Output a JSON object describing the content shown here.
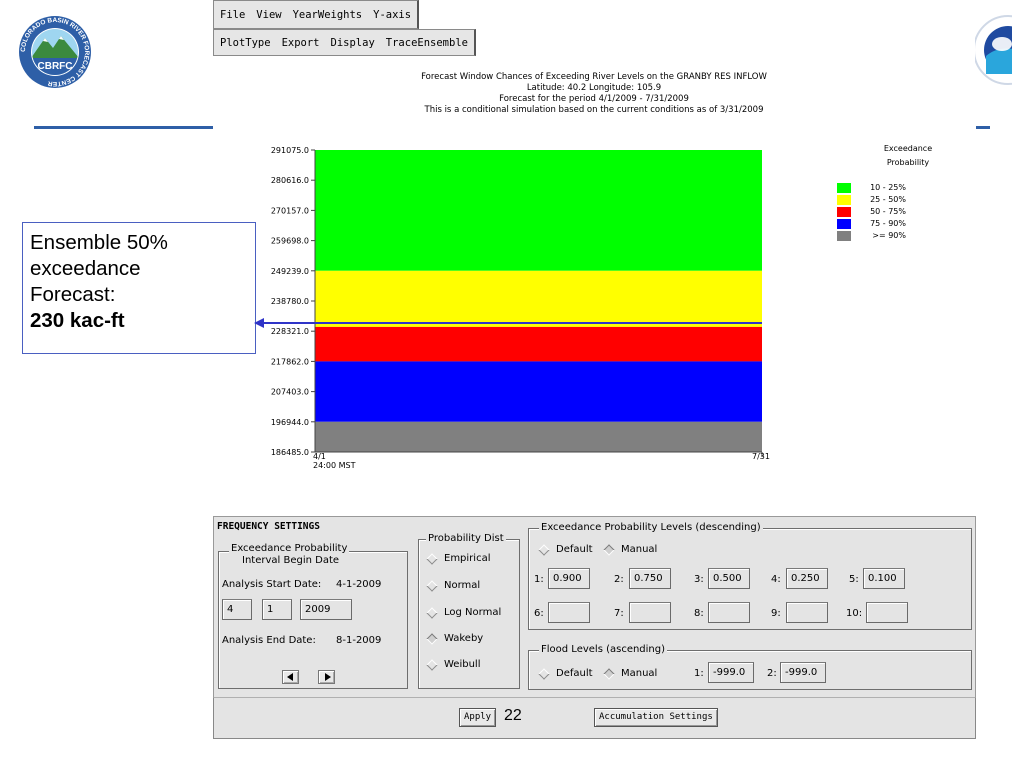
{
  "header": {
    "logo_left": {
      "icon": "cbrfc-logo-icon",
      "ring_text": "COLORADO BASIN RIVER FORECAST CENTER",
      "center_text": "CBRFC",
      "colors": {
        "ring": "#2e5fa7",
        "mountain": "#3b8a3e",
        "sky": "#87c9ea"
      }
    },
    "logo_right": {
      "icon": "noaa-logo-icon"
    },
    "rule_color": "#2e5fa7"
  },
  "menubar": {
    "row1": [
      "File",
      "View",
      "YearWeights",
      "Y-axis"
    ],
    "row2": [
      "PlotType",
      "Export",
      "Display",
      "TraceEnsemble"
    ]
  },
  "chart_title": {
    "line1": "Forecast Window Chances of Exceeding River Levels on the GRANBY RES INFLOW",
    "line2": "Latitude: 40.2    Longitude: 105.9",
    "line3": "Forecast for the period 4/1/2009 - 7/31/2009",
    "line4": "This is a conditional simulation based on the current conditions as of 3/31/2009"
  },
  "chart_data": {
    "type": "area",
    "title": "Forecast Window Chances of Exceeding River Levels on the GRANBY RES INFLOW",
    "x_tick_labels": [
      "4/1\n24:00 MST",
      "7/31"
    ],
    "y_ticks": [
      "291075.0",
      "280616.0",
      "270157.0",
      "259698.0",
      "249239.0",
      "238780.0",
      "228321.0",
      "217862.0",
      "207403.0",
      "196944.0",
      "186485.0"
    ],
    "ylim": [
      186485.0,
      291075.0
    ],
    "bands": [
      {
        "label": "10 - 25%",
        "from": 249239.0,
        "to": 291075.0,
        "color": "#00ff00"
      },
      {
        "label": "25 - 50%",
        "from": 229800.0,
        "to": 249239.0,
        "color": "#ffff00"
      },
      {
        "label": "50 - 75%",
        "from": 217862.0,
        "to": 229800.0,
        "color": "#ff0000"
      },
      {
        "label": "75 - 90%",
        "from": 196944.0,
        "to": 217862.0,
        "color": "#0000ff"
      },
      {
        "label": ">= 90%",
        "from": 186485.0,
        "to": 196944.0,
        "color": "#808080"
      }
    ],
    "legend_title": "Exceedance\nProbability",
    "legend_position": "right",
    "grid": false
  },
  "legend": {
    "title1": "Exceedance",
    "title2": "Probability",
    "items": [
      {
        "label": "10 - 25%",
        "color": "#00ff00"
      },
      {
        "label": "25 - 50%",
        "color": "#ffff00"
      },
      {
        "label": "50 - 75%",
        "color": "#ff0000"
      },
      {
        "label": "75 - 90%",
        "color": "#0000ff"
      },
      {
        "label": ">= 90%",
        "color": "#808080"
      }
    ]
  },
  "callout": {
    "line1": "Ensemble 50%",
    "line2": "exceedance",
    "line3": "Forecast:",
    "line4": "230 kac-ft",
    "arrow_color": "#2f34c8"
  },
  "frequency_settings": {
    "title": "FREQUENCY SETTINGS",
    "interval_group": {
      "legend1": "Exceedance Probability",
      "legend2": "Interval Begin Date",
      "start_label": "Analysis Start Date:",
      "start_value": "4-1-2009",
      "month": "4",
      "day": "1",
      "year": "2009",
      "end_label": "Analysis End Date:",
      "end_value": "8-1-2009"
    },
    "prob_dist": {
      "legend": "Probability Dist",
      "options": [
        "Empirical",
        "Normal",
        "Log Normal",
        "Wakeby",
        "Weibull"
      ],
      "selected": "Wakeby"
    },
    "exceed_levels": {
      "legend": "Exceedance Probability Levels (descending)",
      "default_label": "Default",
      "manual_label": "Manual",
      "selected": "Manual",
      "fields": [
        {
          "n": "1:",
          "value": "0.900"
        },
        {
          "n": "2:",
          "value": "0.750"
        },
        {
          "n": "3:",
          "value": "0.500"
        },
        {
          "n": "4:",
          "value": "0.250"
        },
        {
          "n": "5:",
          "value": "0.100"
        },
        {
          "n": "6:",
          "value": ""
        },
        {
          "n": "7:",
          "value": ""
        },
        {
          "n": "8:",
          "value": ""
        },
        {
          "n": "9:",
          "value": ""
        },
        {
          "n": "10:",
          "value": ""
        }
      ]
    },
    "flood_levels": {
      "legend": "Flood Levels (ascending)",
      "default_label": "Default",
      "manual_label": "Manual",
      "selected": "Manual",
      "f1_label": "1:",
      "f1_value": "-999.0",
      "f2_label": "2:",
      "f2_value": "-999.0"
    }
  },
  "footer": {
    "apply_label": "Apply",
    "page_number": "22",
    "accum_label": "Accumulation Settings"
  }
}
